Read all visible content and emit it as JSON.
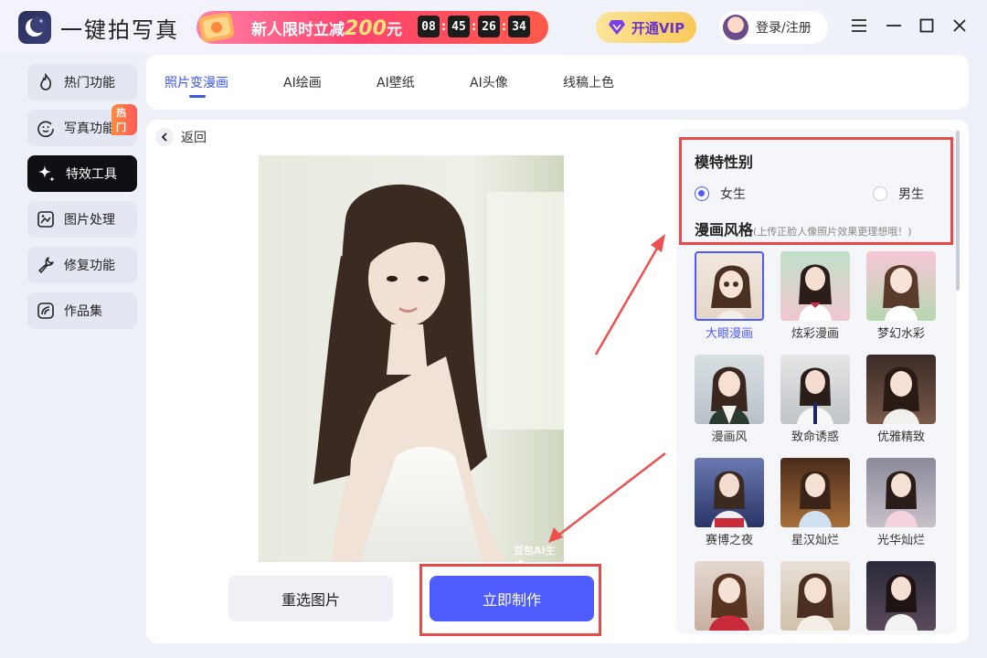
{
  "app": {
    "title": "一键拍写真"
  },
  "promo": {
    "text_prefix": "新人限时立减",
    "amount": "200",
    "unit": "元",
    "countdown": [
      "08",
      "45",
      "26",
      "34"
    ]
  },
  "vip": {
    "label": "开通VIP"
  },
  "login": {
    "label": "登录/注册"
  },
  "sidebar": {
    "items": [
      {
        "label": "热门功能",
        "icon": "flame-icon"
      },
      {
        "label": "写真功能",
        "icon": "smile-icon",
        "badge": "热门"
      },
      {
        "label": "特效工具",
        "icon": "sparkle-icon"
      },
      {
        "label": "图片处理",
        "icon": "image-edit-icon"
      },
      {
        "label": "修复功能",
        "icon": "wrench-icon"
      },
      {
        "label": "作品集",
        "icon": "gallery-icon"
      }
    ],
    "active_index": 2
  },
  "tabs": {
    "items": [
      "照片变漫画",
      "AI绘画",
      "AI壁纸",
      "AI头像",
      "线稿上色"
    ],
    "active_index": 0
  },
  "main": {
    "back_label": "返回",
    "watermark": "豆包AI生成",
    "reselect_label": "重选图片",
    "make_label": "立即制作"
  },
  "panel": {
    "gender_title": "模特性别",
    "gender_options": [
      {
        "label": "女生",
        "checked": true
      },
      {
        "label": "男生",
        "checked": false
      }
    ],
    "style_title": "漫画风格",
    "style_hint": "(上传正脸人像照片效果更理想哦！)",
    "styles": [
      {
        "label": "大眼漫画",
        "selected": true
      },
      {
        "label": "炫彩漫画",
        "selected": false
      },
      {
        "label": "梦幻水彩",
        "selected": false
      },
      {
        "label": "漫画风",
        "selected": false
      },
      {
        "label": "致命诱惑",
        "selected": false
      },
      {
        "label": "优雅精致",
        "selected": false
      },
      {
        "label": "赛博之夜",
        "selected": false
      },
      {
        "label": "星汉灿烂",
        "selected": false
      },
      {
        "label": "光华灿烂",
        "selected": false
      },
      {
        "label": "",
        "selected": false
      },
      {
        "label": "",
        "selected": false
      },
      {
        "label": "",
        "selected": false
      }
    ]
  },
  "colors": {
    "accent": "#4e5bff",
    "highlight": "#e84a4a",
    "promo": "#ff4470",
    "vip_text": "#6a32c9"
  }
}
